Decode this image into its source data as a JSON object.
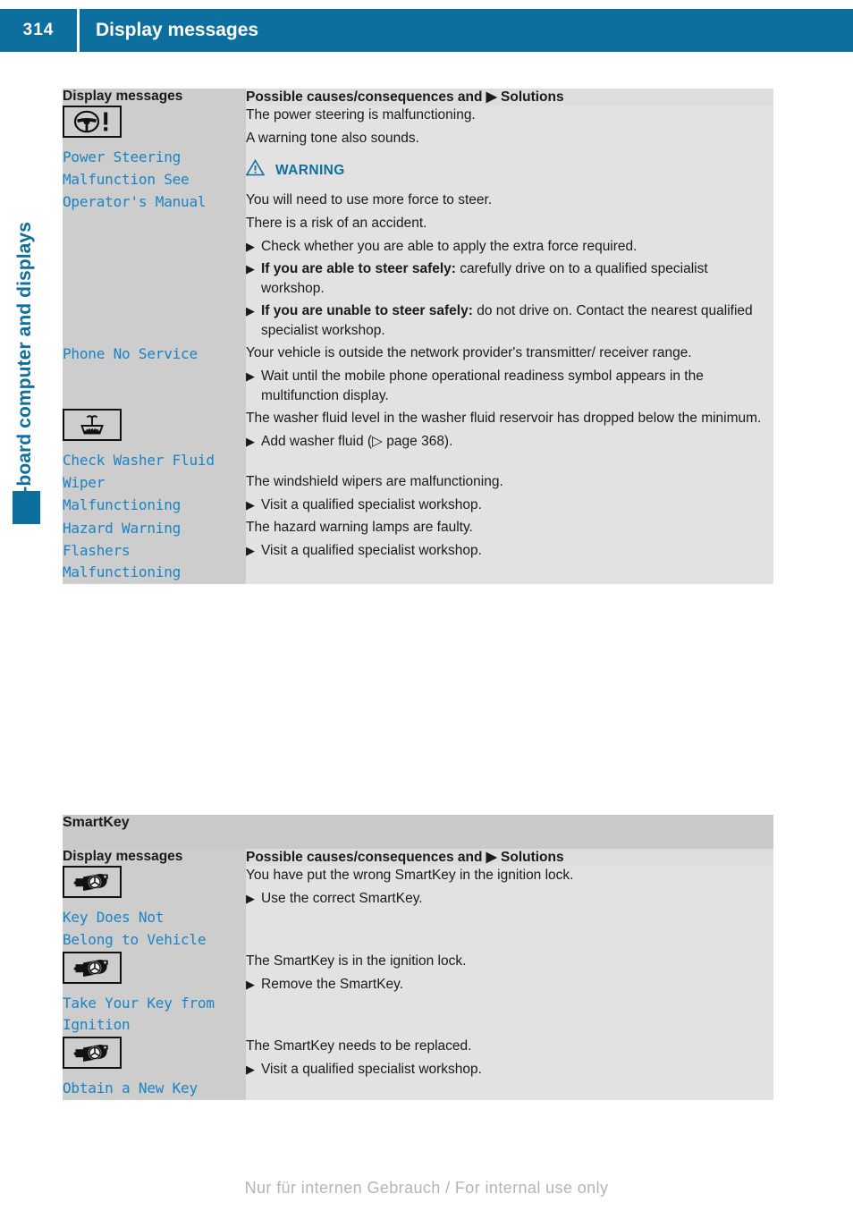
{
  "header": {
    "page_number": "314",
    "title": "Display messages"
  },
  "side_label": {
    "chapter": "On-board computer and displays"
  },
  "tables": [
    {
      "section_title": null,
      "columns": {
        "left": "Display messages",
        "right": "Possible causes/consequences and ▶ Solutions"
      },
      "rows": [
        {
          "icon": "steering-wheel-warning-icon",
          "message": "Power Steering\nMalfunction See\nOperator's Manual",
          "paragraphs": [
            "The power steering is malfunctioning.",
            "A warning tone also sounds."
          ],
          "warning": {
            "label": "WARNING",
            "paragraphs": [
              "You will need to use more force to steer.",
              "There is a risk of an accident."
            ]
          },
          "bullets": [
            {
              "bold": "",
              "text": "Check whether you are able to apply the extra force required."
            },
            {
              "bold": "If you are able to steer safely:",
              "text": " carefully drive on to a qualified specialist workshop."
            },
            {
              "bold": "If you are unable to steer safely:",
              "text": " do not drive on. Contact the nearest qualified specialist workshop."
            }
          ]
        },
        {
          "icon": null,
          "message": "Phone No Service",
          "paragraphs": [
            "Your vehicle is outside the network provider's transmitter/ receiver range."
          ],
          "bullets": [
            {
              "bold": "",
              "text": "Wait until the mobile phone operational readiness symbol appears in the multifunction display."
            }
          ]
        },
        {
          "icon": "washer-fluid-icon",
          "message": "Check Washer Fluid",
          "paragraphs": [
            "The washer fluid level in the washer fluid reservoir has dropped below the minimum."
          ],
          "bullets": [
            {
              "bold": "",
              "text": "Add washer fluid (▷ page 368)."
            }
          ]
        },
        {
          "icon": null,
          "message": "Wiper\nMalfunctioning",
          "paragraphs": [
            "The windshield wipers are malfunctioning."
          ],
          "bullets": [
            {
              "bold": "",
              "text": "Visit a qualified specialist workshop."
            }
          ]
        },
        {
          "icon": null,
          "message": "Hazard Warning\nFlashers\nMalfunctioning",
          "paragraphs": [
            "The hazard warning lamps are faulty."
          ],
          "bullets": [
            {
              "bold": "",
              "text": "Visit a qualified specialist workshop."
            }
          ]
        }
      ]
    },
    {
      "section_title": "SmartKey",
      "columns": {
        "left": "Display messages",
        "right": "Possible causes/consequences and ▶ Solutions"
      },
      "rows": [
        {
          "icon": "smartkey-icon",
          "message": "Key Does Not\nBelong to Vehicle",
          "paragraphs": [
            "You have put the wrong SmartKey in the ignition lock."
          ],
          "bullets": [
            {
              "bold": "",
              "text": "Use the correct SmartKey."
            }
          ]
        },
        {
          "icon": "smartkey-icon",
          "message": "Take Your Key from\nIgnition",
          "paragraphs": [
            "The SmartKey is in the ignition lock."
          ],
          "bullets": [
            {
              "bold": "",
              "text": "Remove the SmartKey."
            }
          ]
        },
        {
          "icon": "smartkey-icon",
          "message": "Obtain a New Key",
          "paragraphs": [
            "The SmartKey needs to be replaced."
          ],
          "bullets": [
            {
              "bold": "",
              "text": "Visit a qualified specialist workshop."
            }
          ]
        }
      ]
    }
  ],
  "footer": {
    "watermark": "Nur für internen Gebrauch / For internal use only"
  },
  "colors": {
    "brand_blue": "#0d6f9e",
    "code_blue": "#1a83c4",
    "header_gray": "#cdcdcd",
    "body_gray": "#e2e2e2",
    "section_gray": "#c9c9c9"
  }
}
